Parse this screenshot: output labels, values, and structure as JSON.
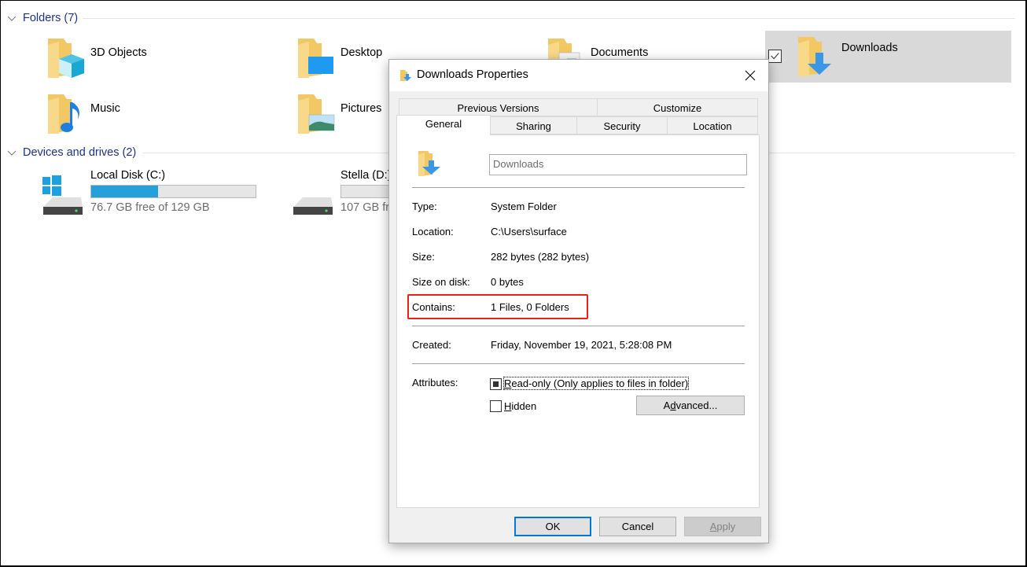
{
  "explorer": {
    "folders_group": {
      "label": "Folders (7)"
    },
    "folders": [
      {
        "name": "3D Objects",
        "icon": "folder-3d-objects-icon",
        "selected": false
      },
      {
        "name": "Desktop",
        "icon": "folder-desktop-icon",
        "selected": false
      },
      {
        "name": "Documents",
        "icon": "folder-documents-icon",
        "selected": false
      },
      {
        "name": "Downloads",
        "icon": "folder-downloads-icon",
        "selected": true,
        "checked": true
      },
      {
        "name": "Music",
        "icon": "folder-music-icon",
        "selected": false
      },
      {
        "name": "Pictures",
        "icon": "folder-pictures-icon",
        "selected": false
      }
    ],
    "drives_group": {
      "label": "Devices and drives (2)"
    },
    "drives": [
      {
        "name": "Local Disk (C:)",
        "free_text": "76.7 GB free of 129 GB",
        "used_fraction": 0.405,
        "icon": "windows-drive-icon"
      },
      {
        "name": "Stella (D:)",
        "free_text": "107 GB fr",
        "used_fraction": 0.0,
        "icon": "hard-drive-icon"
      }
    ]
  },
  "dialog": {
    "title": "Downloads Properties",
    "tabs_back": [
      "Previous Versions",
      "Customize"
    ],
    "tabs_front": [
      "General",
      "Sharing",
      "Security",
      "Location"
    ],
    "active_tab": "General",
    "name_value": "Downloads",
    "properties": {
      "type_label": "Type:",
      "type_value": "System Folder",
      "location_label": "Location:",
      "location_value": "C:\\Users\\surface",
      "size_label": "Size:",
      "size_value": "282 bytes (282 bytes)",
      "size_on_disk_label": "Size on disk:",
      "size_on_disk_value": "0 bytes",
      "contains_label": "Contains:",
      "contains_value": "1 Files, 0 Folders",
      "created_label": "Created:",
      "created_value": "Friday, November 19, 2021, 5:28:08 PM",
      "attributes_label": "Attributes:"
    },
    "attributes": {
      "readonly_label": "Read-only (Only applies to files in folder)",
      "readonly_state": "indeterminate",
      "hidden_label": "Hidden",
      "hidden_checked": false,
      "advanced_label": "Advanced..."
    },
    "buttons": {
      "ok": "OK",
      "cancel": "Cancel",
      "apply": "Apply"
    },
    "highlight_color": "#e8211b"
  }
}
